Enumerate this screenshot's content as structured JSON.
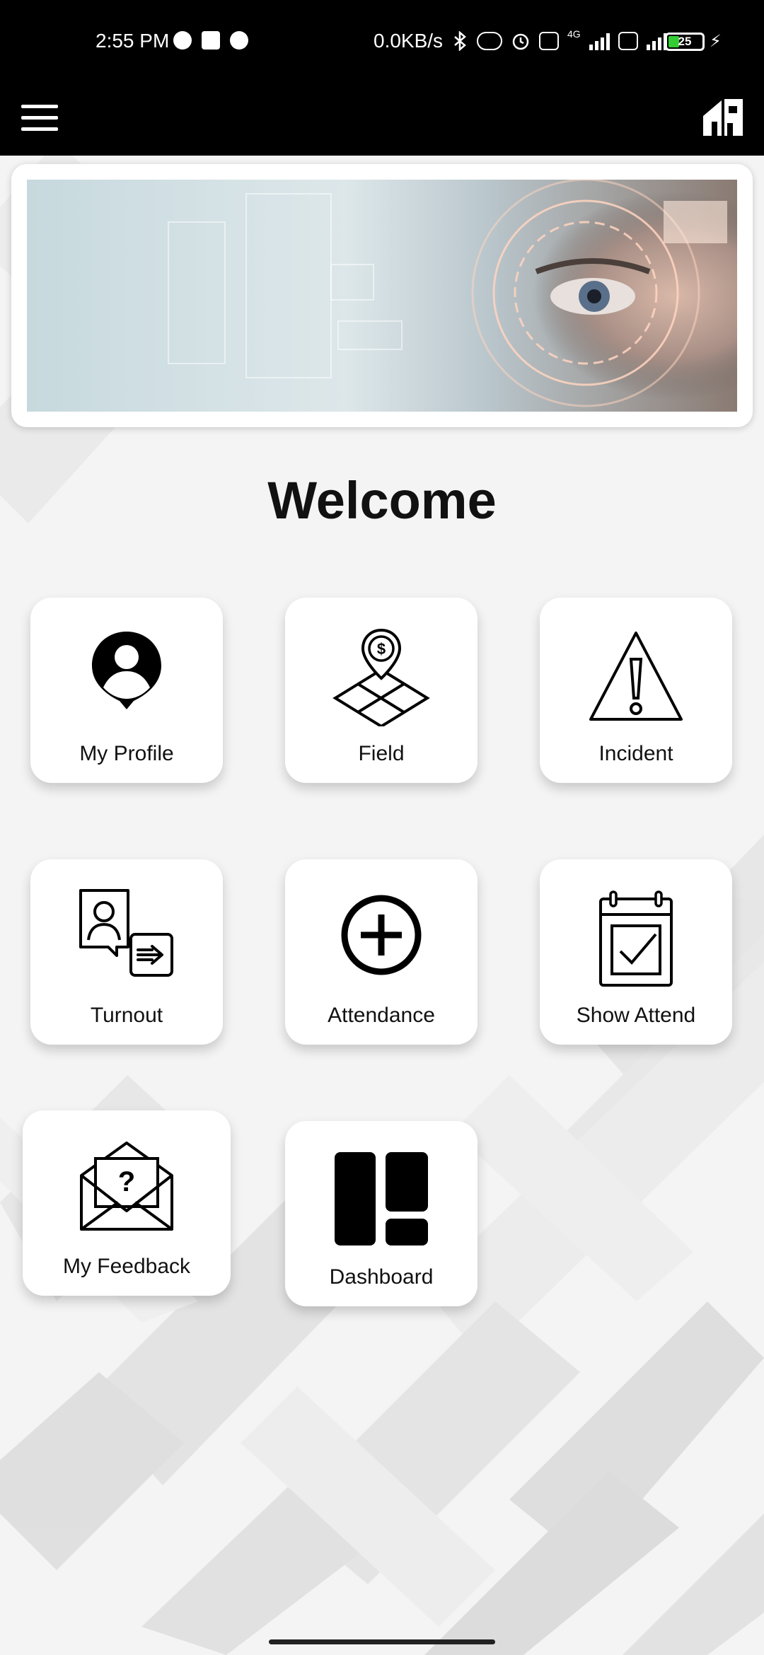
{
  "status_bar": {
    "time": "2:55 PM",
    "network_speed": "0.0KB/s",
    "network_type": "4G",
    "battery": "25"
  },
  "app_bar": {
    "menu_icon": "hamburger-menu-icon",
    "home_icon": "home-icon"
  },
  "banner": {
    "image": "cyber-security-face-banner"
  },
  "main": {
    "welcome": "Welcome",
    "tiles": [
      {
        "label": "My Profile",
        "icon": "user-pin-icon"
      },
      {
        "label": "Field",
        "icon": "map-dollar-icon"
      },
      {
        "label": "Incident",
        "icon": "warning-icon"
      },
      {
        "label": "Turnout",
        "icon": "user-exit-icon"
      },
      {
        "label": "Attendance",
        "icon": "add-circle-icon"
      },
      {
        "label": "Show Attend",
        "icon": "calendar-check-icon"
      },
      {
        "label": "My Feedback",
        "icon": "mail-question-icon"
      },
      {
        "label": "Dashboard",
        "icon": "dashboard-icon"
      }
    ]
  },
  "colors": {
    "app_bar": "#000000",
    "tile_bg": "#ffffff",
    "page_bg": "#f3f3f3",
    "text": "#111111"
  }
}
